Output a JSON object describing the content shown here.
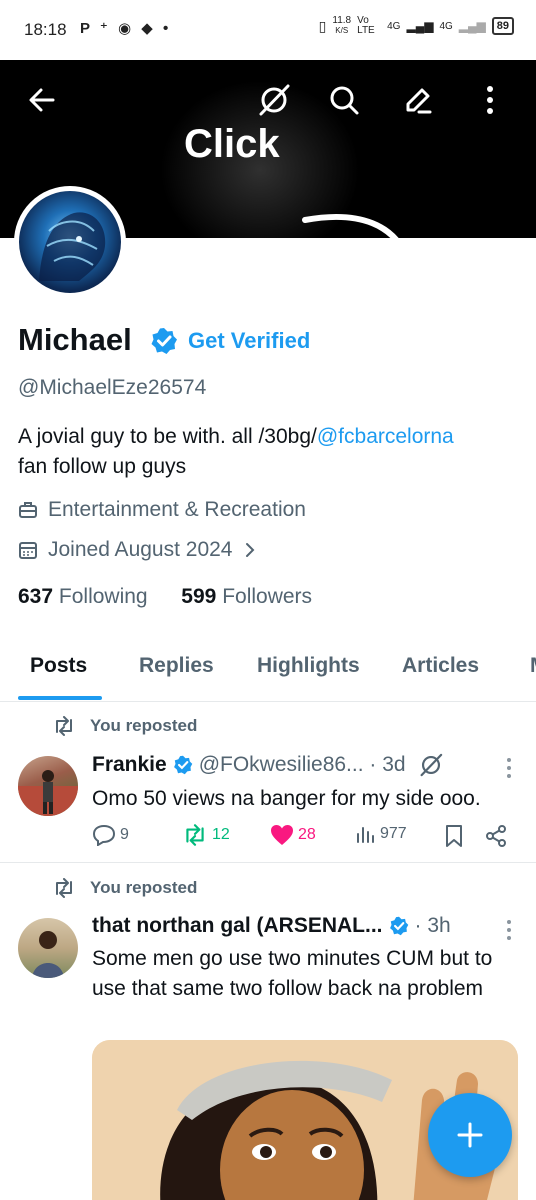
{
  "status_bar": {
    "time": "18:18",
    "notification_icons": "P ⁺ ◉ ◆ •",
    "network_speed": "11.8",
    "network_unit": "K/S",
    "volte": "Vo LTE",
    "sim1": "4G",
    "sim2": "4G",
    "battery": "89"
  },
  "header": {
    "banner_text": "Click",
    "back_icon": "arrow-left-icon",
    "grok_icon": "grok-icon",
    "search_icon": "search-icon",
    "edit_icon": "pencil-icon",
    "more_icon": "more-vertical-icon"
  },
  "profile": {
    "name": "Michael",
    "get_verified": "Get Verified",
    "handle": "@MichaelEze26574",
    "bio_prefix": "A jovial guy to be with. all /30bg/",
    "bio_mention": "@fcbarcelorna",
    "bio_suffix": "fan  follow up guys",
    "category": "Entertainment & Recreation",
    "joined": "Joined August 2024",
    "following_count": "637",
    "following_label": "Following",
    "followers_count": "599",
    "followers_label": "Followers"
  },
  "tabs": [
    {
      "label": "Posts"
    },
    {
      "label": "Replies"
    },
    {
      "label": "Highlights"
    },
    {
      "label": "Articles"
    }
  ],
  "posts": [
    {
      "repost_label": "You reposted",
      "name": "Frankie",
      "handle_time": "@FOkwesilie86... · 3d",
      "text": "Omo 50 views na banger for my side ooo.",
      "replies": "9",
      "reposts": "12",
      "likes": "28",
      "views": "977"
    },
    {
      "repost_label": "You reposted",
      "name": "that northan gal (ARSENAL...",
      "handle_time": "· 3h",
      "text": "Some men go use two minutes CUM but to use that same two follow back na problem"
    }
  ],
  "colors": {
    "accent": "#1d9bf0",
    "repost_green": "#00ba7c",
    "like_pink": "#f91880",
    "muted": "#536471"
  }
}
